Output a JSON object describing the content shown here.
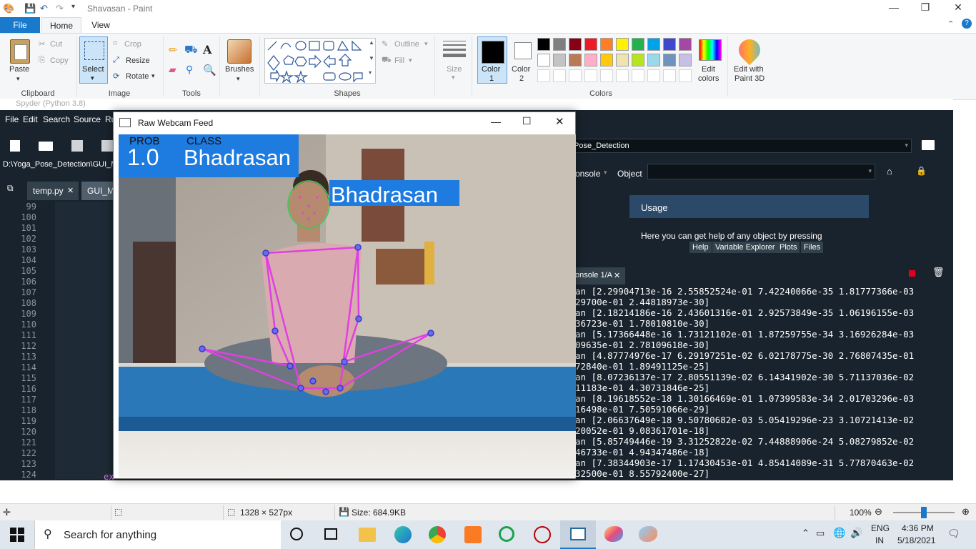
{
  "paint": {
    "title": "Shavasan - Paint",
    "tabs": {
      "file": "File",
      "home": "Home",
      "view": "View"
    },
    "clipboard": {
      "paste": "Paste",
      "cut": "Cut",
      "copy": "Copy",
      "label": "Clipboard"
    },
    "image": {
      "select": "Select",
      "crop": "Crop",
      "resize": "Resize",
      "rotate": "Rotate",
      "label": "Image"
    },
    "tools": {
      "label": "Tools"
    },
    "brushes": {
      "label": "Brushes"
    },
    "shapes": {
      "outline": "Outline",
      "fill": "Fill",
      "label": "Shapes"
    },
    "size": {
      "label": "Size"
    },
    "colors": {
      "color1": "Color",
      "color1_num": "1",
      "color2": "Color",
      "color2_num": "2",
      "edit": "Edit",
      "edit2": "colors",
      "label": "Colors",
      "palette_row1": [
        "#000000",
        "#7f7f7f",
        "#880015",
        "#ed1c24",
        "#ff7f27",
        "#fff200",
        "#22b14c",
        "#00a2e8",
        "#3f48cc",
        "#a349a4"
      ],
      "palette_row2": [
        "#ffffff",
        "#c3c3c3",
        "#b97a57",
        "#ffaec9",
        "#ffc90e",
        "#efe4b0",
        "#b5e61d",
        "#99d9ea",
        "#7092be",
        "#c8bfe7"
      ]
    },
    "paint3d": {
      "line1": "Edit with",
      "line2": "Paint 3D"
    },
    "status": {
      "dimensions": "1328 × 527px",
      "size": "Size: 684.9KB",
      "zoom": "100%"
    }
  },
  "spyder": {
    "title": "Spyder (Python 3.8)",
    "menu": [
      "File",
      "Edit",
      "Search",
      "Source",
      "Ru"
    ],
    "left_path": "D:\\Yoga_Pose_Detection\\GUI_M",
    "right_path": "Pose_Detection",
    "tabs": [
      "temp.py",
      "GUI_Ma"
    ],
    "line_numbers": [
      "99",
      "100",
      "101",
      "102",
      "103",
      "104",
      "105",
      "106",
      "107",
      "108",
      "109",
      "110",
      "111",
      "112",
      "113",
      "114",
      "115",
      "116",
      "117",
      "118",
      "119",
      "120",
      "121",
      "122",
      "123",
      "124"
    ],
    "code_fragment": "ex",
    "help": {
      "source": "onsole",
      "object_label": "Object",
      "usage_title": "Usage",
      "usage_text": "Here you can get help of any object by pressing",
      "pane_tabs": [
        "Help",
        "Variable Explorer",
        "Plots",
        "Files"
      ]
    },
    "console_tab": "onsole 1/A",
    "console_lines": [
      "an [2.29904713e-16 2.55852524e-01 7.42240066e-35 1.81777366e-03",
      "29700e-01 2.44818973e-30]",
      "an [2.18214186e-16 2.43601316e-01 2.92573849e-35 1.06196155e-03",
      "36723e-01 1.78010810e-30]",
      "an [5.17366448e-16 1.73121102e-01 1.87259755e-34 3.16926284e-03",
      "09635e-01 2.78109618e-30]",
      "an [4.87774976e-17 6.29197251e-02 6.02178775e-30 2.76807435e-01",
      "72840e-01 1.89491125e-25]",
      "an [8.07236137e-17 2.80551139e-02 6.14341902e-30 5.71137036e-02",
      "11183e-01 4.30731846e-25]",
      "an [8.19618552e-18 1.30166469e-01 1.07399583e-34 2.01703296e-03",
      "16498e-01 7.50591066e-29]",
      "an [2.06637649e-18 9.50780682e-03 5.05419296e-23 3.10721413e-02",
      "20052e-01 9.08361701e-18]",
      "an [5.85749446e-19 3.31252822e-02 7.44888906e-24 5.08279852e-02",
      "46733e-01 4.94347486e-18]",
      "an [7.38344903e-17 1.17430453e-01 4.85414089e-31 5.77870463e-02",
      "32500e-01 8.55792400e-27]"
    ]
  },
  "webcam": {
    "title": "Raw Webcam Feed",
    "prob_label": "PROB",
    "class_label": "CLASS",
    "prob_value": "1.0",
    "class_value": "Bhadrasan",
    "head_label": "Bhadrasan"
  },
  "taskbar": {
    "search_placeholder": "Search for anything",
    "lang1": "ENG",
    "lang2": "IN",
    "time": "4:36 PM",
    "date": "5/18/2021"
  }
}
